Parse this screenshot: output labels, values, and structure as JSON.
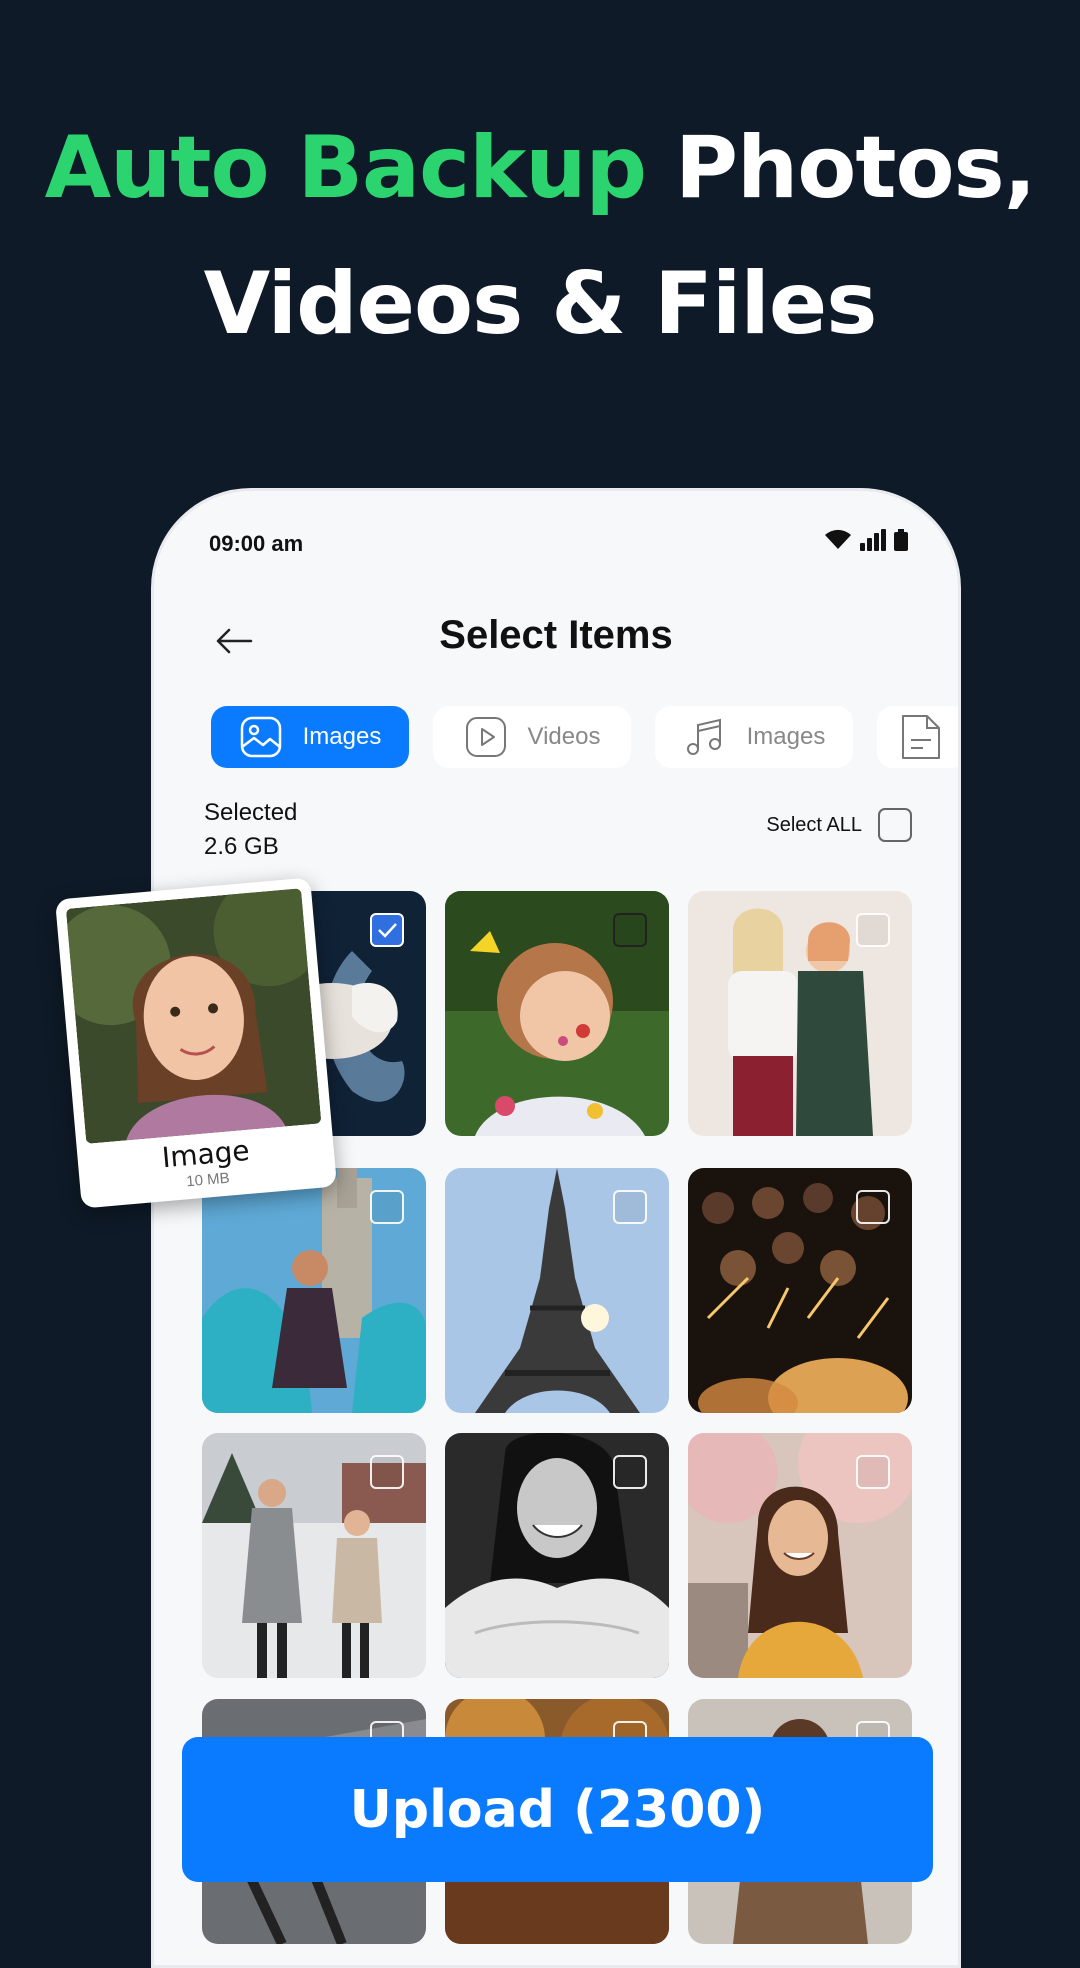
{
  "headline": {
    "accent": "Auto Backup",
    "rest": " Photos,",
    "line2": "Videos & Files"
  },
  "status": {
    "time": "09:00 am"
  },
  "nav": {
    "title": "Select Items"
  },
  "tabs": [
    {
      "label": "Images",
      "icon": "image-icon",
      "active": true
    },
    {
      "label": "Videos",
      "icon": "video-icon",
      "active": false
    },
    {
      "label": "Images",
      "icon": "music-icon",
      "active": false
    },
    {
      "label": "",
      "icon": "document-icon",
      "active": false
    }
  ],
  "selection": {
    "label": "Selected",
    "size": "2.6 GB",
    "select_all": "Select ALL"
  },
  "card": {
    "label": "Image",
    "size": "10 MB"
  },
  "thumbnails": [
    {
      "name": "baby-on-moon",
      "checked": true
    },
    {
      "name": "painted-child",
      "checked": false
    },
    {
      "name": "two-women-laughing",
      "checked": false
    },
    {
      "name": "woman-in-car",
      "checked": false
    },
    {
      "name": "eiffel-tower",
      "checked": false
    },
    {
      "name": "sparklers-crowd",
      "checked": false
    },
    {
      "name": "two-girls-snow",
      "checked": false
    },
    {
      "name": "smiling-woman-bw",
      "checked": false
    },
    {
      "name": "woman-yellow-sweater",
      "checked": false
    },
    {
      "name": "partial-row-1",
      "checked": false
    },
    {
      "name": "partial-row-2",
      "checked": false
    },
    {
      "name": "partial-row-3",
      "checked": false
    }
  ],
  "upload": {
    "label": "Upload (2300)"
  },
  "colors": {
    "background": "#0e1a27",
    "accent_green": "#2bd46f",
    "primary_blue": "#0a7bff"
  }
}
